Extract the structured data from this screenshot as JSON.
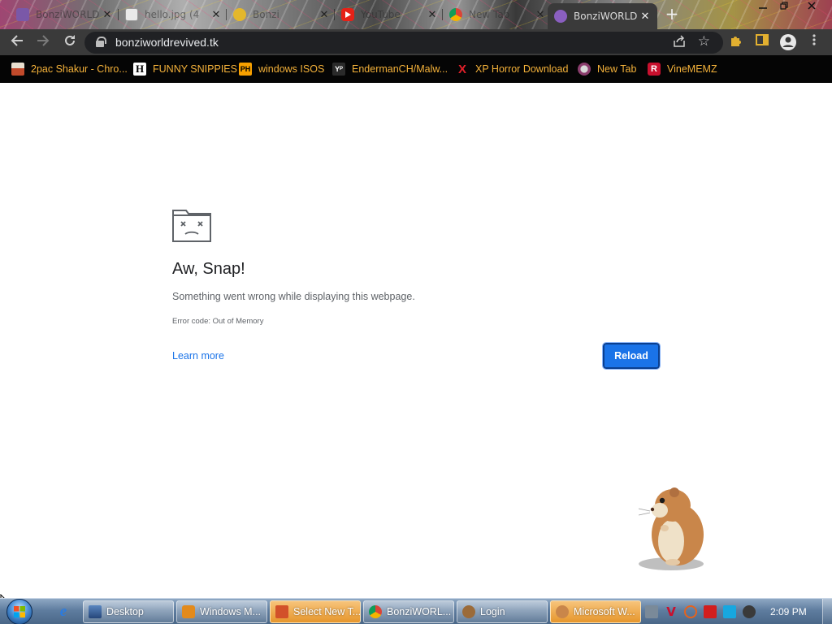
{
  "browser": {
    "tabs": [
      {
        "title": "BonziWORLD",
        "favicon": "bonzi-favicon"
      },
      {
        "title": "hello.jpg (4",
        "favicon": "image-favicon"
      },
      {
        "title": "Bonzi",
        "favicon": "bonzi-coin-favicon"
      },
      {
        "title": "YouTube",
        "favicon": "youtube-favicon"
      },
      {
        "title": "New Tab",
        "favicon": "chrome-favicon"
      },
      {
        "title": "BonziWORLD",
        "favicon": "bonzi-favicon",
        "active": true
      }
    ],
    "tab_close_glyph": "✕",
    "new_tab_glyph": "+",
    "url": "bonziworldrevived.tk",
    "bookmarks": [
      {
        "label": "2pac Shakur - Chro...",
        "icon": "folder-icon",
        "icon_glyph": ""
      },
      {
        "label": "FUNNY SNIPPIES",
        "icon": "h-icon",
        "icon_glyph": "H"
      },
      {
        "label": "windows ISOS",
        "icon": "ph-icon",
        "icon_glyph": "PH"
      },
      {
        "label": "EndermanCH/Malw...",
        "icon": "yp-icon",
        "icon_glyph": "Yᴾ"
      },
      {
        "label": "XP Horror Download",
        "icon": "x-icon",
        "icon_glyph": "X"
      },
      {
        "label": "New Tab",
        "icon": "globe-icon",
        "icon_glyph": ""
      },
      {
        "label": "VineMEMZ",
        "icon": "r-icon",
        "icon_glyph": "R"
      }
    ]
  },
  "error_page": {
    "title": "Aw, Snap!",
    "description": "Something went wrong while displaying this webpage.",
    "error_code": "Error code: Out of Memory",
    "learn_more": "Learn more",
    "reload": "Reload"
  },
  "taskbar": {
    "tasks": [
      {
        "label": "Desktop",
        "icon": "desktop-icon"
      },
      {
        "label": "Windows M...",
        "icon": "media-player-icon"
      },
      {
        "label": "Select New T...",
        "icon": "tool-icon",
        "highlight": true
      },
      {
        "label": "BonziWORL...",
        "icon": "chrome-icon"
      },
      {
        "label": "Login",
        "icon": "bonzi-icon"
      },
      {
        "label": "Microsoft W...",
        "icon": "agent-icon",
        "highlight": true
      }
    ],
    "clock": "2:09 PM"
  },
  "colors": {
    "link": "#1a73e8",
    "bookmark_text": "#f5b23a",
    "toolbar": "#3a3a3a",
    "omnibox": "#202124"
  }
}
